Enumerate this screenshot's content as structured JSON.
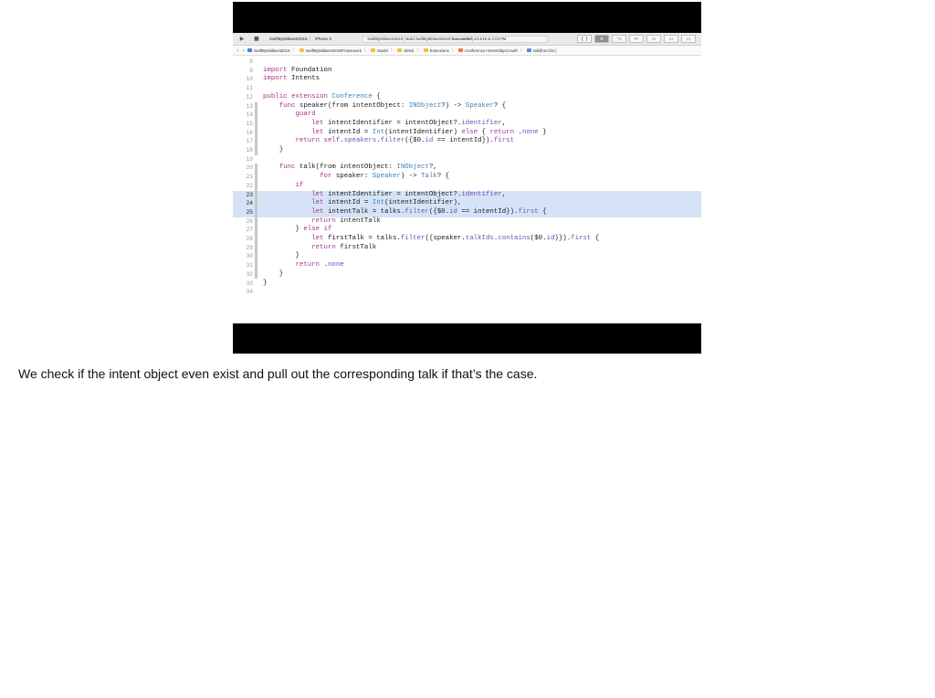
{
  "toolbar": {
    "run_icon": "play-icon",
    "stop_icon": "stop-icon",
    "scheme": "SwiftByMidwest2019",
    "destination": "iPhone X",
    "status_prefix": "SwiftByMidwest2019 | Build SwiftByMidwest2019: ",
    "status_result": "Succeeded",
    "status_time": " | 4/14/18 at 1:03 PM",
    "library_icon": "{ }",
    "editor_modes": [
      "≡",
      "⌥",
      "↩"
    ],
    "panel_toggles": [
      "▭",
      "▭",
      "▭"
    ]
  },
  "jumpbar": {
    "back_icon": "‹",
    "forward_icon": "›",
    "crumbs": [
      "SwiftByMidwest2019",
      "SwiftByMidwest2019Framework",
      "Model",
      "SiriKit",
      "Extensions",
      "Conference+IntentObject.swift",
      "talk(from:for:)"
    ]
  },
  "editor": {
    "lines": [
      {
        "n": "8",
        "code": "",
        "hl": false,
        "cur": false
      },
      {
        "n": "9",
        "code": "import Foundation",
        "hl": false,
        "cur": false
      },
      {
        "n": "10",
        "code": "import Intents",
        "hl": false,
        "cur": false
      },
      {
        "n": "11",
        "code": "",
        "hl": false,
        "cur": false
      },
      {
        "n": "12",
        "code": "public extension Conference {",
        "hl": false,
        "cur": false
      },
      {
        "n": "13",
        "code": "    func speaker(from intentObject: INObject?) -> Speaker? {",
        "hl": false,
        "cur": false
      },
      {
        "n": "14",
        "code": "        guard",
        "hl": false,
        "cur": false
      },
      {
        "n": "15",
        "code": "            let intentIdentifier = intentObject?.identifier,",
        "hl": false,
        "cur": false
      },
      {
        "n": "16",
        "code": "            let intentId = Int(intentIdentifier) else { return .none }",
        "hl": false,
        "cur": false
      },
      {
        "n": "17",
        "code": "        return self.speakers.filter({$0.id == intentId}).first",
        "hl": false,
        "cur": false
      },
      {
        "n": "18",
        "code": "    }",
        "hl": false,
        "cur": false
      },
      {
        "n": "19",
        "code": "",
        "hl": false,
        "cur": false
      },
      {
        "n": "20",
        "code": "    func talk(from intentObject: INObject?,",
        "hl": false,
        "cur": false
      },
      {
        "n": "21",
        "code": "              for speaker: Speaker) -> Talk? {",
        "hl": false,
        "cur": false
      },
      {
        "n": "22",
        "code": "        if",
        "hl": false,
        "cur": false
      },
      {
        "n": "23",
        "code": "            let intentIdentifier = intentObject?.identifier,",
        "hl": true,
        "cur": true
      },
      {
        "n": "24",
        "code": "            let intentId = Int(intentIdentifier),",
        "hl": true,
        "cur": true
      },
      {
        "n": "25",
        "code": "            let intentTalk = talks.filter({$0.id == intentId}).first {",
        "hl": true,
        "cur": true
      },
      {
        "n": "26",
        "code": "            return intentTalk",
        "hl": false,
        "cur": false
      },
      {
        "n": "27",
        "code": "        } else if",
        "hl": false,
        "cur": false
      },
      {
        "n": "28",
        "code": "            let firstTalk = talks.filter({speaker.talkIds.contains($0.id)}).first {",
        "hl": false,
        "cur": false
      },
      {
        "n": "29",
        "code": "            return firstTalk",
        "hl": false,
        "cur": false
      },
      {
        "n": "30",
        "code": "        }",
        "hl": false,
        "cur": false
      },
      {
        "n": "31",
        "code": "        return .none",
        "hl": false,
        "cur": false
      },
      {
        "n": "32",
        "code": "    }",
        "hl": false,
        "cur": false
      },
      {
        "n": "33",
        "code": "}",
        "hl": false,
        "cur": false
      },
      {
        "n": "34",
        "code": "",
        "hl": false,
        "cur": false
      }
    ]
  },
  "caption": "We check if the intent object even exist and pull out the corresponding talk if that’s the case.",
  "colors": {
    "keyword": "#a4348f",
    "type": "#3d7fb5",
    "member": "#6e51b5",
    "selection": "#d6e3f7",
    "text": "#1a1a1a"
  }
}
